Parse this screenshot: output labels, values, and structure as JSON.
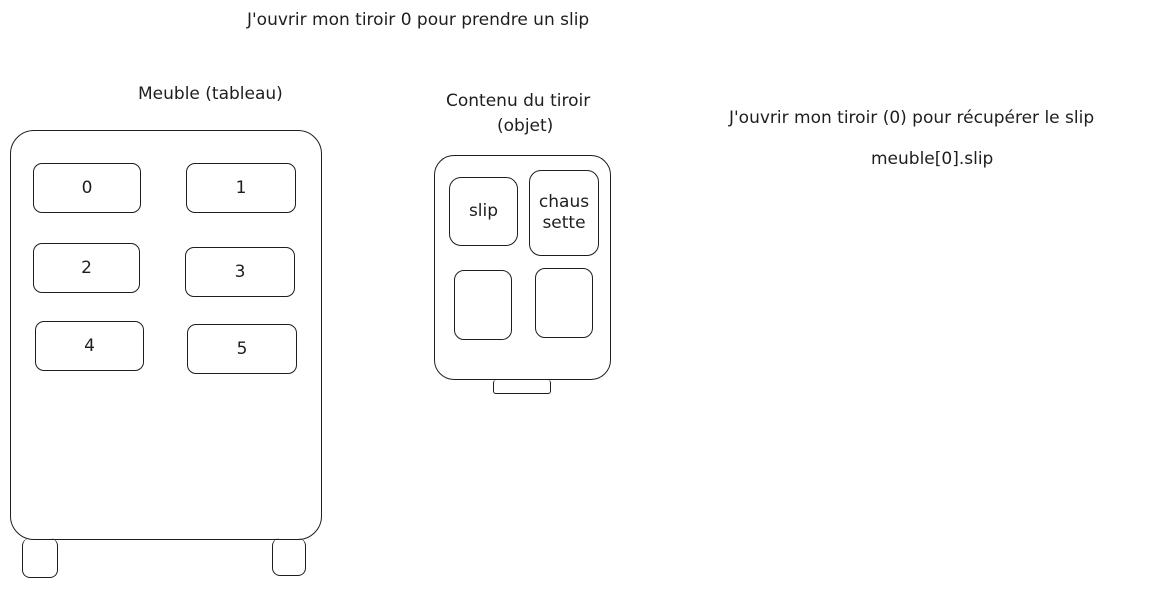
{
  "texts": {
    "top_caption": "J'ouvrir mon tiroir 0 pour prendre un slip",
    "furniture_label": "Meuble (tableau)",
    "drawer_label_line1": "Contenu du tiroir",
    "drawer_label_line2": "(objet)",
    "right_caption": "J'ouvrir mon tiroir (0) pour récupérer le slip",
    "code_caption": "meuble[0].slip"
  },
  "furniture": {
    "drawers": [
      "0",
      "1",
      "2",
      "3",
      "4",
      "5"
    ]
  },
  "drawer_contents": {
    "items": [
      "slip",
      "chaus\nsette",
      "",
      ""
    ]
  }
}
